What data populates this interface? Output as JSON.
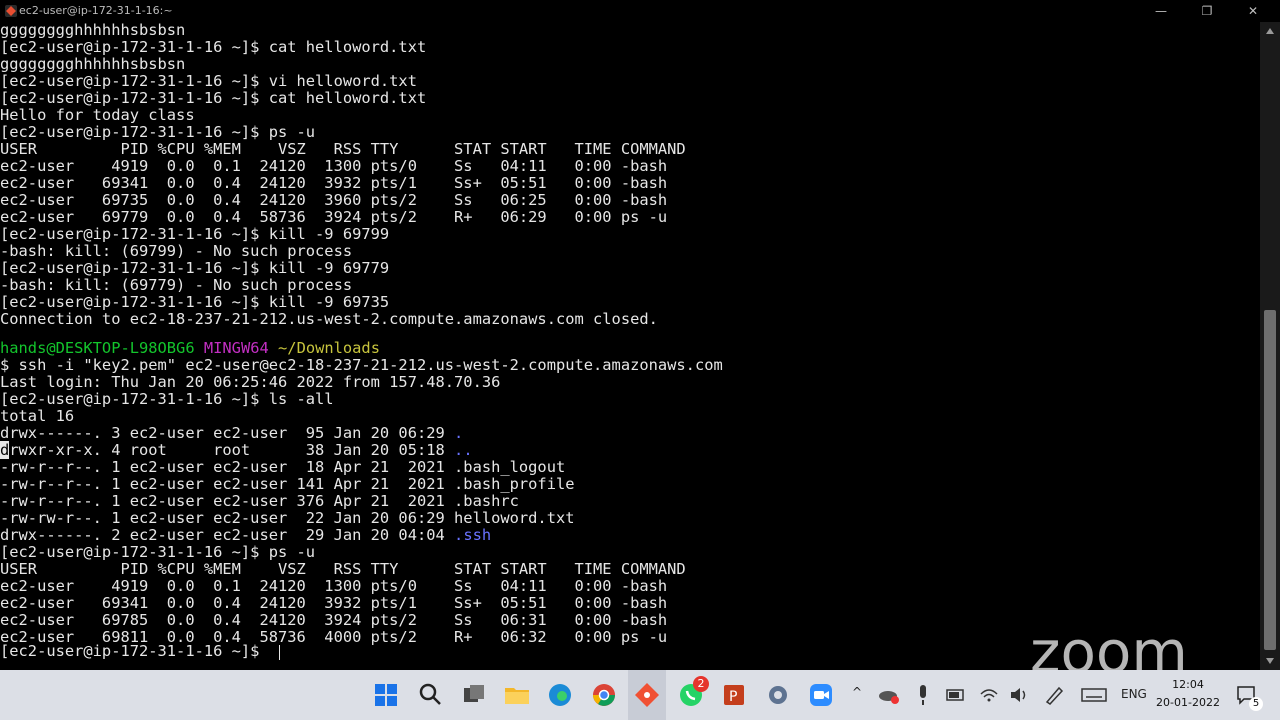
{
  "window": {
    "title": "ec2-user@ip-172-31-1-16:~",
    "minimize": "—",
    "maximize": "❐",
    "close": "✕"
  },
  "terminal": {
    "l01": "gggggggghhhhhhsbsbsn",
    "l02": "[ec2-user@ip-172-31-1-16 ~]$ cat helloword.txt",
    "l03": "gggggggghhhhhhsbsbsn",
    "l04": "[ec2-user@ip-172-31-1-16 ~]$ vi helloword.txt",
    "l05": "[ec2-user@ip-172-31-1-16 ~]$ cat helloword.txt",
    "l06": "Hello for today class",
    "l07": "[ec2-user@ip-172-31-1-16 ~]$ ps -u",
    "l08": "USER         PID %CPU %MEM    VSZ   RSS TTY      STAT START   TIME COMMAND",
    "l09": "ec2-user    4919  0.0  0.1  24120  1300 pts/0    Ss   04:11   0:00 -bash",
    "l10": "ec2-user   69341  0.0  0.4  24120  3932 pts/1    Ss+  05:51   0:00 -bash",
    "l11": "ec2-user   69735  0.0  0.4  24120  3960 pts/2    Ss   06:25   0:00 -bash",
    "l12": "ec2-user   69779  0.0  0.4  58736  3924 pts/2    R+   06:29   0:00 ps -u",
    "l13": "[ec2-user@ip-172-31-1-16 ~]$ kill -9 69799",
    "l14": "-bash: kill: (69799) - No such process",
    "l15": "[ec2-user@ip-172-31-1-16 ~]$ kill -9 69779",
    "l16": "-bash: kill: (69779) - No such process",
    "l17": "[ec2-user@ip-172-31-1-16 ~]$ kill -9 69735",
    "l18": "Connection to ec2-18-237-21-212.us-west-2.compute.amazonaws.com closed.",
    "l20_user": "hands@DESKTOP-L98OBG6",
    "l20_env": "MINGW64",
    "l20_path": "~/Downloads",
    "l21": "$ ssh -i \"key2.pem\" ec2-user@ec2-18-237-21-212.us-west-2.compute.amazonaws.com",
    "l22": "Last login: Thu Jan 20 06:25:46 2022 from 157.48.70.36",
    "l23": "[ec2-user@ip-172-31-1-16 ~]$ ls -all",
    "l24": "total 16",
    "l25a": "drwx------. 3 ec2-user ec2-user  95 Jan 20 06:29 ",
    "l25b": ".",
    "l26c": "d",
    "l26a": "rwxr-xr-x. 4 root     root      38 Jan 20 05:18 ",
    "l26b": "..",
    "l27": "-rw-r--r--. 1 ec2-user ec2-user  18 Apr 21  2021 .bash_logout",
    "l28": "-rw-r--r--. 1 ec2-user ec2-user 141 Apr 21  2021 .bash_profile",
    "l29": "-rw-r--r--. 1 ec2-user ec2-user 376 Apr 21  2021 .bashrc",
    "l30": "-rw-rw-r--. 1 ec2-user ec2-user  22 Jan 20 06:29 helloword.txt",
    "l31a": "drwx------. 2 ec2-user ec2-user  29 Jan 20 04:04 ",
    "l31b": ".ssh",
    "l32": "[ec2-user@ip-172-31-1-16 ~]$ ps -u",
    "l33": "USER         PID %CPU %MEM    VSZ   RSS TTY      STAT START   TIME COMMAND",
    "l34": "ec2-user    4919  0.0  0.1  24120  1300 pts/0    Ss   04:11   0:00 -bash",
    "l35": "ec2-user   69341  0.0  0.4  24120  3932 pts/1    Ss+  05:51   0:00 -bash",
    "l36": "ec2-user   69785  0.0  0.4  24120  3924 pts/2    Ss   06:31   0:00 -bash",
    "l37": "ec2-user   69811  0.0  0.4  58736  4000 pts/2    R+   06:32   0:00 ps -u",
    "l38": "[ec2-user@ip-172-31-1-16 ~]$ "
  },
  "overlay": {
    "logo_text": "zoom"
  },
  "taskbar": {
    "language": "ENG",
    "time": "12:04",
    "date": "20-01-2022",
    "whatsapp_badge": "2",
    "notification_count": "5"
  },
  "colors": {
    "terminal_bg": "#000000",
    "terminal_fg": "#e6e6e6",
    "prompt_green": "#13c52c",
    "prompt_magenta": "#c32fc3",
    "prompt_yellow": "#c7c43d",
    "dir_blue": "#6a73ff"
  }
}
